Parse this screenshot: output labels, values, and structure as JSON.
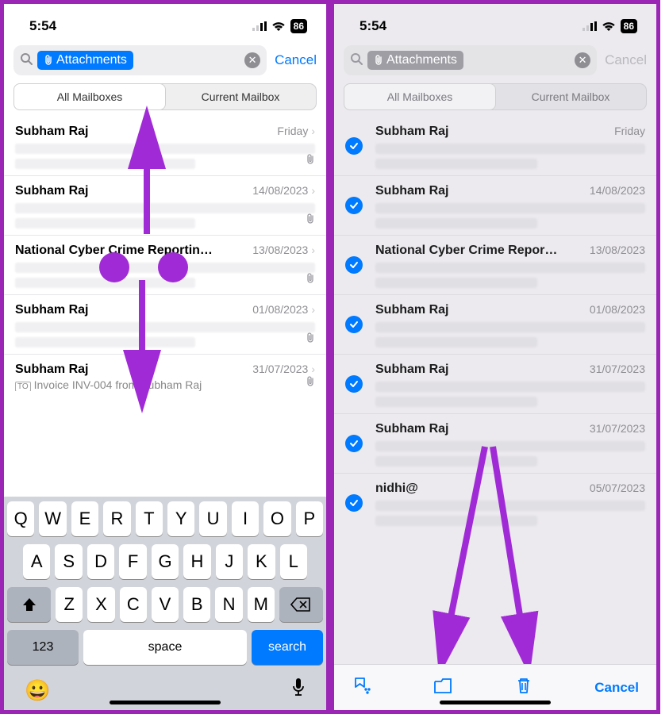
{
  "statusbar": {
    "time": "5:54",
    "battery": "86"
  },
  "search": {
    "token_label": "Attachments",
    "cancel": "Cancel"
  },
  "scope": {
    "all": "All Mailboxes",
    "current": "Current Mailbox"
  },
  "left_rows": [
    {
      "sender": "Subham Raj",
      "when": "Friday"
    },
    {
      "sender": "Subham Raj",
      "when": "14/08/2023"
    },
    {
      "sender": "National Cyber Crime Reportin…",
      "when": "13/08/2023"
    },
    {
      "sender": "Subham Raj",
      "when": "01/08/2023"
    },
    {
      "sender": "Subham Raj",
      "when": "31/07/2023",
      "preview": "Invoice INV-004 from Subham Raj"
    }
  ],
  "right_rows": [
    {
      "sender": "Subham Raj",
      "when": "Friday"
    },
    {
      "sender": "Subham Raj",
      "when": "14/08/2023"
    },
    {
      "sender": "National Cyber Crime Repor…",
      "when": "13/08/2023"
    },
    {
      "sender": "Subham Raj",
      "when": "01/08/2023"
    },
    {
      "sender": "Subham Raj",
      "when": "31/07/2023"
    },
    {
      "sender": "Subham Raj",
      "when": "31/07/2023"
    },
    {
      "sender": "nidhi@",
      "when": "05/07/2023"
    }
  ],
  "keyboard": {
    "r1": [
      "Q",
      "W",
      "E",
      "R",
      "T",
      "Y",
      "U",
      "I",
      "O",
      "P"
    ],
    "r2": [
      "A",
      "S",
      "D",
      "F",
      "G",
      "H",
      "J",
      "K",
      "L"
    ],
    "r3": [
      "Z",
      "X",
      "C",
      "V",
      "B",
      "N",
      "M"
    ],
    "num": "123",
    "space": "space",
    "search": "search"
  },
  "toolbar": {
    "cancel": "Cancel"
  }
}
